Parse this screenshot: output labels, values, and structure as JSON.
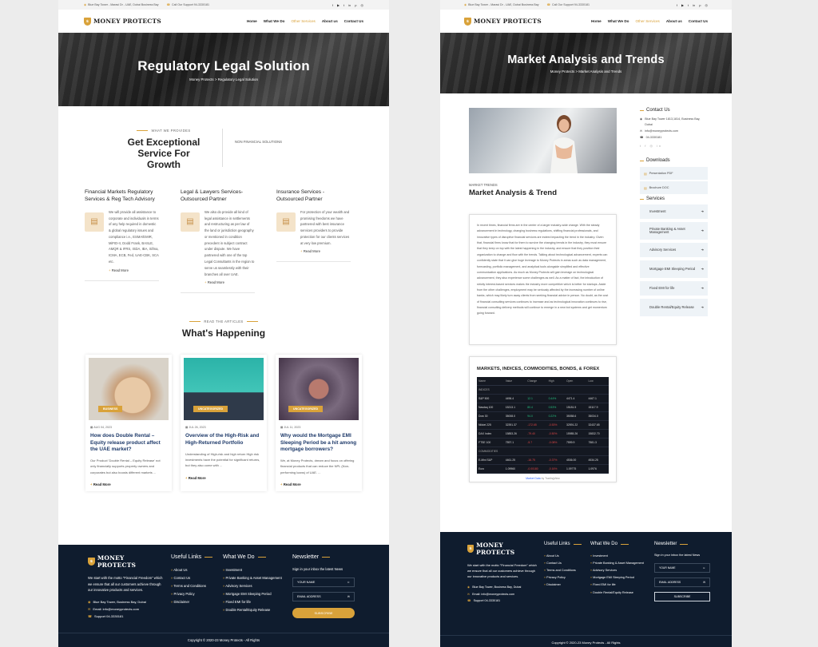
{
  "topbar": {
    "address": "Blue Bay Tower - Marasi Dr - UAE, Dubai Business Bay",
    "support": "Call Our Support 94-3330181",
    "social": [
      "f",
      "▶",
      "t",
      "in",
      "p",
      "◎"
    ]
  },
  "brand": {
    "name": "MONEY PROTECTS"
  },
  "nav": {
    "home": "Home",
    "what_we_do": "What We Do",
    "other_services": "Other Services",
    "about": "About us",
    "contact": "Contact Us"
  },
  "left": {
    "hero": {
      "title": "Regulatory Legal Solution",
      "breadcrumb": "Money Protects > Regulatory Legal Solution"
    },
    "provides": {
      "tag": "WHAT WE PROVIDES",
      "title": "Get Exceptional Service For Growth",
      "nonfin": "NON FINANCIAL SOLUTIONS"
    },
    "services": [
      {
        "title": "Financial Markets Regulatory Services & Reg Tech Advisory",
        "text": "We will provide all assistance to corporate and individuals in terms of any help required in domestic & global regulatory issues and compliance i.e., ESMA/EMIR, MiFID-II, Dodd Frank, BASLE, AMQR & IFRS, ISDA, IBA, Sifma, ICMA, ECB, Fed, UAE-CBK, SCA etc.",
        "link": "Read More"
      },
      {
        "title": "Legal & Lawyers Services-Outsourced Partner",
        "text": "We also do provide all kind of legal assistance in settlements and restructuring as per law of the land or jurisdiction geography or mentioned in condition precedent in subject contract under dispute. We have partnered with one of the top Legal Consultants in the region to serve us seamlessly with their branches all over UAE.",
        "link": "Read More"
      },
      {
        "title": "Insurance Services - Outsourced Partner",
        "text": "For protection of your wealth and promising freedoms we have partnered with best insurance services providers to provide protection for our clients services at very low premium.",
        "link": "Read More"
      }
    ],
    "articles": {
      "tag": "READ THE ARTICLES",
      "title": "What's Happening",
      "items": [
        {
          "badge": "BUSINESS",
          "date": "AUG 04, 2023",
          "title": "How does Double Rental – Equity release product affect the UAE market?",
          "text": "Our Product 'Double Rental – Equity Release' not only financially supports property owners and corporates but also boosts different markets ...",
          "link": "Read More"
        },
        {
          "badge": "UNCATEGORIZED",
          "date": "JUL 26, 2023",
          "title": "Overview of the High-Risk and High-Returned Portfolio",
          "text": "Understanding of High-risk and high return High risk investments have the potential for significant returns, but they also come with ...",
          "link": "Read More"
        },
        {
          "badge": "UNCATEGORIZED",
          "date": "JUL 11, 2023",
          "title": "Why would the Mortgage EMI Sleeping Period be a hit among mortgage borrowers?",
          "text": "We, at Money Protects, dream and focus on offering financial products that can reduce the NPL (Non-performing loans) of UAE. ...",
          "link": "Read More"
        }
      ]
    }
  },
  "right": {
    "hero": {
      "title": "Market Analysis and Trends",
      "breadcrumb": "Money Protects > Market Analysis and Trends"
    },
    "tag": "MARKET TRENDS",
    "title": "Market Analysis & Trend",
    "text": "In recent times, financial firms are in the center of a larger industry-wide change. With the steady advancement in technology, changing business regulations, shifting financial professionals, and innovative types of disruptive financial services are indeed impacting the trend in the industry. Given that, financial firms know that for them to survive the changing trends in the industry, they must ensure that they keep on top with the latest happening in the industry, and ensure that they position their organization to change and flow with the trends. Talking about technological advancement, experts can confidently state that it can give huge leverage to Money Protects in areas such as data management, forecasting, portfolio management, and analytical tools alongside simplified and effective communication applications. As much as Money Protects will gain leverage on technological advancement, they also experience some challenges as well. As a matter of fact, the introduction of strictly interest-based services makes the industry more competitive which is better for startups. Aside from the other challenges, employment may be seriously affected by the increasing number of online banks, which may likely turn away clients from seeking financial advice in person. No doubt, as the cost of financial consulting services continues to increase and as technological innovation continues to rise, financial consulting delivery methods will continue to emerge in a new bot systems and get momentum going forward.",
    "markets": {
      "title": "MARKETS, INDICES, COMMODITIES, BONDS, & FOREX",
      "headers": [
        "Name",
        "Value",
        "Change",
        "High",
        "Open",
        "Low"
      ],
      "groups": [
        {
          "name": "INDICES",
          "rows": [
            [
              "S&P 500",
              "4496.4",
              "12.1",
              "0.44%",
              "4471.4",
              "4467.1"
            ],
            [
              "Nasdaq 100",
              "15213.1",
              "80.4",
              "0.53%",
              "15181.5",
              "15117.9"
            ],
            [
              "Dow 30",
              "35008.0",
              "94.0",
              "0.22%",
              "35058.6",
              "35034.0"
            ],
            [
              "Nikkei 225",
              "32391.37",
              "-172.65",
              "-0.53%",
              "32591.22",
              "32437.65"
            ],
            [
              "DAX Index",
              "15853.26",
              "-79.40",
              "-0.50%",
              "15985.26",
              "15832.70"
            ],
            [
              "FTSE 100",
              "7597.1",
              "-5.7",
              "-0.08%",
              "7599.9",
              "7581.3"
            ]
          ]
        },
        {
          "name": "COMMODITIES",
          "rows": [
            [
              "E-Mini S&P",
              "4461.25",
              "-16.75",
              "-0.37%",
              "4536.00",
              "4534.25"
            ],
            [
              "Euro",
              "1.09960",
              "-0.00180",
              "-0.16%",
              "1.09775",
              "1.0976"
            ]
          ]
        }
      ],
      "source": "Market Data",
      "source_suffix": "by TradingView"
    },
    "sidebar": {
      "contact_title": "Contact Us",
      "address": "Blue Bay Tower 1813,1814, Business Bay, Dubai",
      "email": "info@moneyprotects.com",
      "phone": "04-3330181",
      "downloads_title": "Downloads",
      "downloads": [
        "Presentation PDF",
        "Brochure DOC"
      ],
      "services_title": "Services",
      "services": [
        "Investment",
        "Private Banking & Asset Management",
        "Advisory Services",
        "Mortgage EMI Sleeping Period",
        "Fixed EMI for life",
        "Double Rental/Equity Release"
      ]
    }
  },
  "footer": {
    "about": "We start with the motto \"Financial Freedom\" which we ensure that all our customers achieve through our innovative products and services.",
    "address": "Blue Bay Tower, Business Bay, Dubai",
    "email_label": "Email:",
    "email": "info@moneyprotects.com",
    "support_label": "Support",
    "support": "04-3330181",
    "useful_title": "Useful Links",
    "useful": [
      "About Us",
      "Contact Us",
      "Terms and Conditions",
      "Privacy Policy",
      "Disclaimer"
    ],
    "whatwedo_title": "What We Do",
    "whatwedo": [
      "Investment",
      "Private Banking & Asset Management",
      "Advisory Services",
      "Mortgage EMI Sleeping Period",
      "Fixed EMI for life",
      "Double Rental/Equity Release"
    ],
    "newsletter_title": "Newsletter",
    "newsletter_text": "Sign in your inbox the latest News",
    "name_ph": "YOUR NAME",
    "email_ph": "EMAIL ADDRESS",
    "subscribe": "SUBSCRIBE",
    "copyright": "Copyright © 2020-23 Money Protects - All Rights"
  },
  "colors": {
    "accent": "#d9a23a",
    "footer_bg": "#0f1c2e",
    "title_blue": "#1e3a6a"
  }
}
